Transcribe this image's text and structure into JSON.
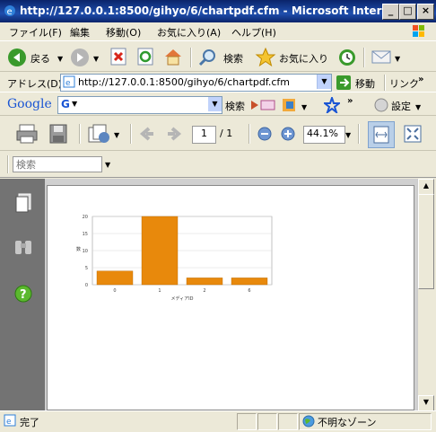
{
  "window": {
    "title": "http://127.0.0.1:8500/gihyo/6/chartpdf.cfm - Microsoft Intern...",
    "min_label": "_",
    "max_label": "□",
    "close_label": "×"
  },
  "menu": {
    "items": [
      "ファイル(F)",
      "編集",
      "移動(O)",
      "お気に入り(A)",
      "ヘルプ(H)"
    ]
  },
  "toolbar": {
    "back_label": "戻る",
    "search_label": "検索",
    "favorites_label": "お気に入り"
  },
  "address": {
    "label": "アドレス(D)",
    "url": "http://127.0.0.1:8500/gihyo/6/chartpdf.cfm",
    "go_label": "移動",
    "links_label": "リンク"
  },
  "google": {
    "logo": "Google",
    "search_label": "検索",
    "settings_label": "設定"
  },
  "pdf": {
    "page_current": "1",
    "page_total": "/ 1",
    "zoom": "44.1%",
    "search_placeholder": "検索"
  },
  "status": {
    "text": "完了",
    "zone": "不明なゾーン"
  },
  "chart_data": {
    "type": "bar",
    "categories": [
      "0",
      "1",
      "2",
      "6"
    ],
    "values": [
      4,
      20,
      2,
      2
    ],
    "xlabel": "メディアID",
    "ylabel": "数",
    "ylim": [
      0,
      20
    ],
    "yticks": [
      0,
      5,
      10,
      15,
      20
    ],
    "bar_color": "#E8890C",
    "grid": true
  }
}
